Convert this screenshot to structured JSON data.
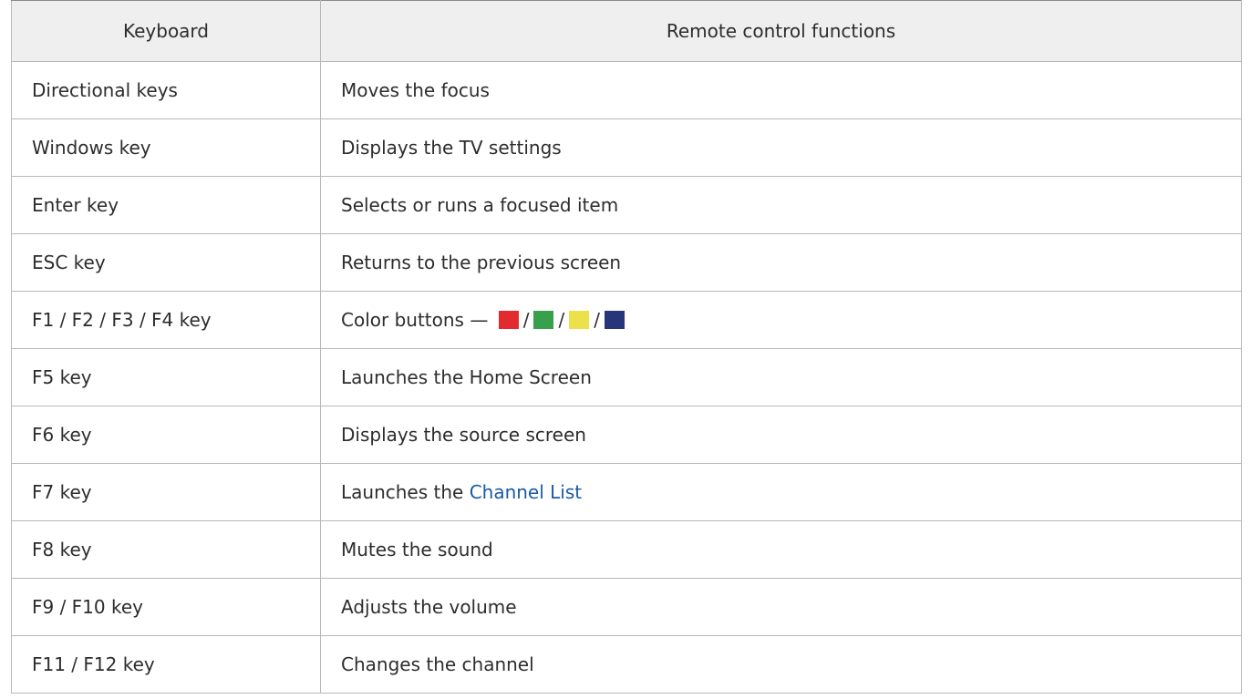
{
  "table": {
    "headers": [
      "Keyboard",
      "Remote control functions"
    ],
    "rows": [
      {
        "key": "Directional keys",
        "function": "Moves the focus"
      },
      {
        "key": "Windows key",
        "function": "Displays the TV settings"
      },
      {
        "key": "Enter key",
        "function": "Selects or runs a focused item"
      },
      {
        "key": "ESC key",
        "function": "Returns to the previous screen"
      },
      {
        "key": "F1 / F2 / F3 / F4 key",
        "function": "Color buttons —",
        "color_buttons": [
          "#e32b2f",
          "#36a14a",
          "#ece14a",
          "#27357b"
        ],
        "separator": "/"
      },
      {
        "key": "F5 key",
        "function": "Launches the Home Screen"
      },
      {
        "key": "F6 key",
        "function": "Displays the source screen"
      },
      {
        "key": "F7 key",
        "function": "Launches the",
        "link": "Channel List"
      },
      {
        "key": "F8 key",
        "function": "Mutes the sound"
      },
      {
        "key": "F9 / F10 key",
        "function": "Adjusts the volume"
      },
      {
        "key": "F11 / F12 key",
        "function": "Changes the channel"
      }
    ]
  },
  "colors": {
    "link": "#1a5aa6",
    "header_bg": "#efefef",
    "border": "#b8b8b8"
  }
}
